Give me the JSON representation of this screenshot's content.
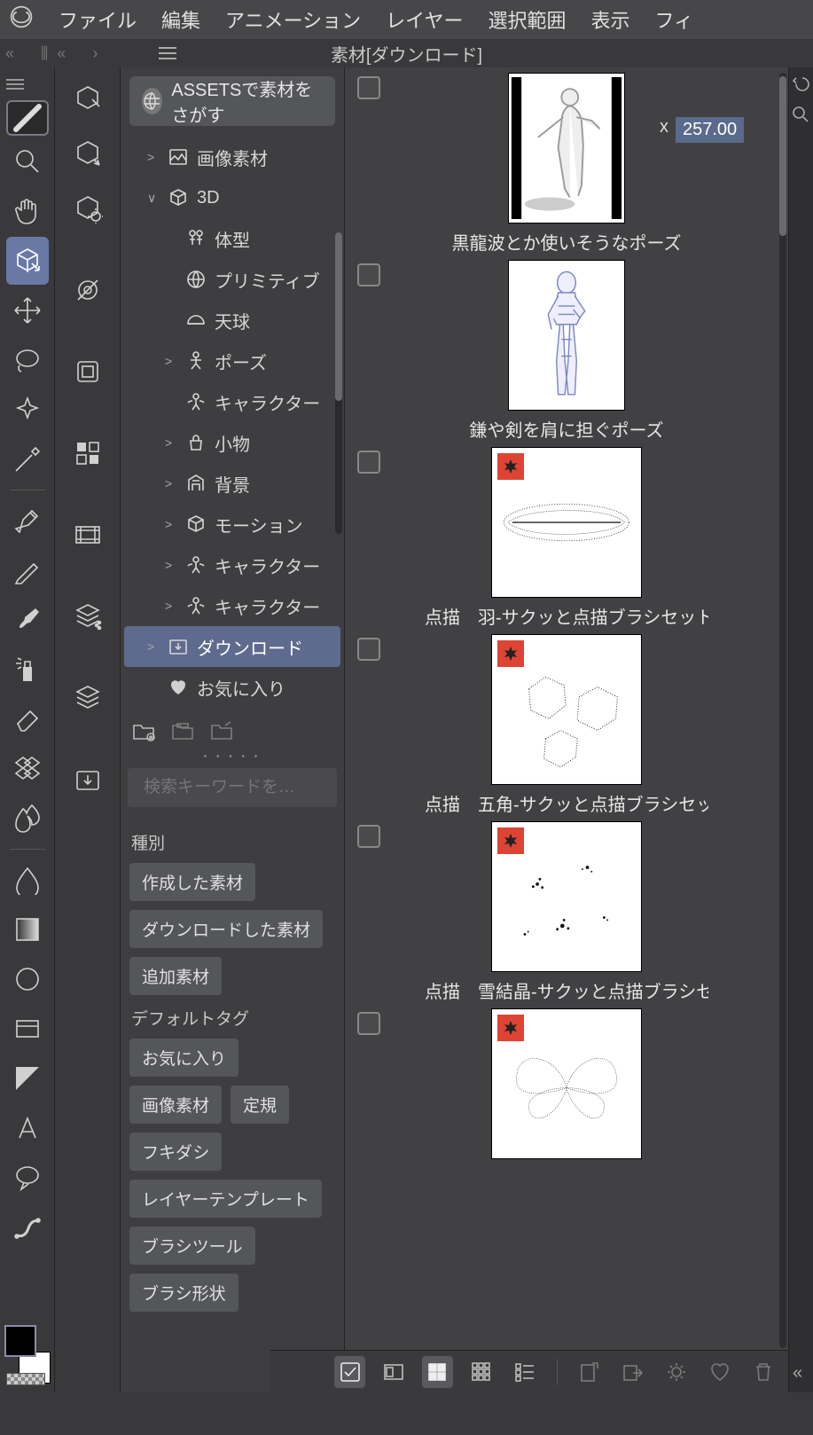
{
  "menu": {
    "items": [
      "ファイル",
      "編集",
      "アニメーション",
      "レイヤー",
      "選択範囲",
      "表示",
      "フィ"
    ]
  },
  "panel": {
    "title": "素材[ダウンロード]"
  },
  "assets_button": "ASSETSで素材をさがす",
  "tree": [
    {
      "depth": 1,
      "chev": ">",
      "icon": "image-icon",
      "label": "画像素材"
    },
    {
      "depth": 1,
      "chev": "∨",
      "icon": "cube-icon",
      "label": "3D"
    },
    {
      "depth": 2,
      "chev": "",
      "icon": "body-icon",
      "label": "体型"
    },
    {
      "depth": 2,
      "chev": "",
      "icon": "globe-icon",
      "label": "プリミティブ"
    },
    {
      "depth": 2,
      "chev": "",
      "icon": "dome-icon",
      "label": "天球"
    },
    {
      "depth": 2,
      "chev": ">",
      "icon": "pose-icon",
      "label": "ポーズ"
    },
    {
      "depth": 2,
      "chev": "",
      "icon": "character-icon",
      "label": "キャラクター"
    },
    {
      "depth": 2,
      "chev": ">",
      "icon": "bag-icon",
      "label": "小物"
    },
    {
      "depth": 2,
      "chev": ">",
      "icon": "building-icon",
      "label": "背景"
    },
    {
      "depth": 2,
      "chev": ">",
      "icon": "cube-icon",
      "label": "モーション"
    },
    {
      "depth": 2,
      "chev": ">",
      "icon": "character-icon",
      "label": "キャラクター"
    },
    {
      "depth": 2,
      "chev": ">",
      "icon": "character-icon",
      "label": "キャラクター"
    },
    {
      "depth": 1,
      "chev": ">",
      "icon": "download-icon",
      "label": "ダウンロード",
      "selected": true
    },
    {
      "depth": 1,
      "chev": "",
      "icon": "heart-icon",
      "label": "お気に入り"
    }
  ],
  "search": {
    "placeholder": "検索キーワードを…"
  },
  "filters": {
    "section1_label": "種別",
    "section1_tags": [
      "作成した素材",
      "ダウンロードした素材",
      "追加素材"
    ],
    "section2_label": "デフォルトタグ",
    "section2_tags": [
      "お気に入り",
      "画像素材",
      "定規",
      "フキダシ",
      "レイヤーテンプレート",
      "ブラシツール",
      "ブラシ形状"
    ]
  },
  "materials": [
    {
      "name": "黒龍波とか使いそうなポーズ",
      "thumb": "pose1",
      "narrow": true,
      "badge": false
    },
    {
      "name": "鎌や剣を肩に担ぐポーズ",
      "thumb": "pose2",
      "narrow": true,
      "badge": false
    },
    {
      "name": "点描　羽-サクッと点描ブラシセット",
      "thumb": "feather",
      "narrow": false,
      "badge": true
    },
    {
      "name": "点描　五角-サクッと点描ブラシセット",
      "thumb": "hex",
      "narrow": false,
      "badge": true
    },
    {
      "name": "点描　雪結晶-サクッと点描ブラシセット",
      "thumb": "snow",
      "narrow": false,
      "badge": true
    },
    {
      "name": "",
      "thumb": "butterfly",
      "narrow": false,
      "badge": true
    }
  ],
  "ruler": {
    "x_prefix": "x",
    "value": "257.00"
  }
}
